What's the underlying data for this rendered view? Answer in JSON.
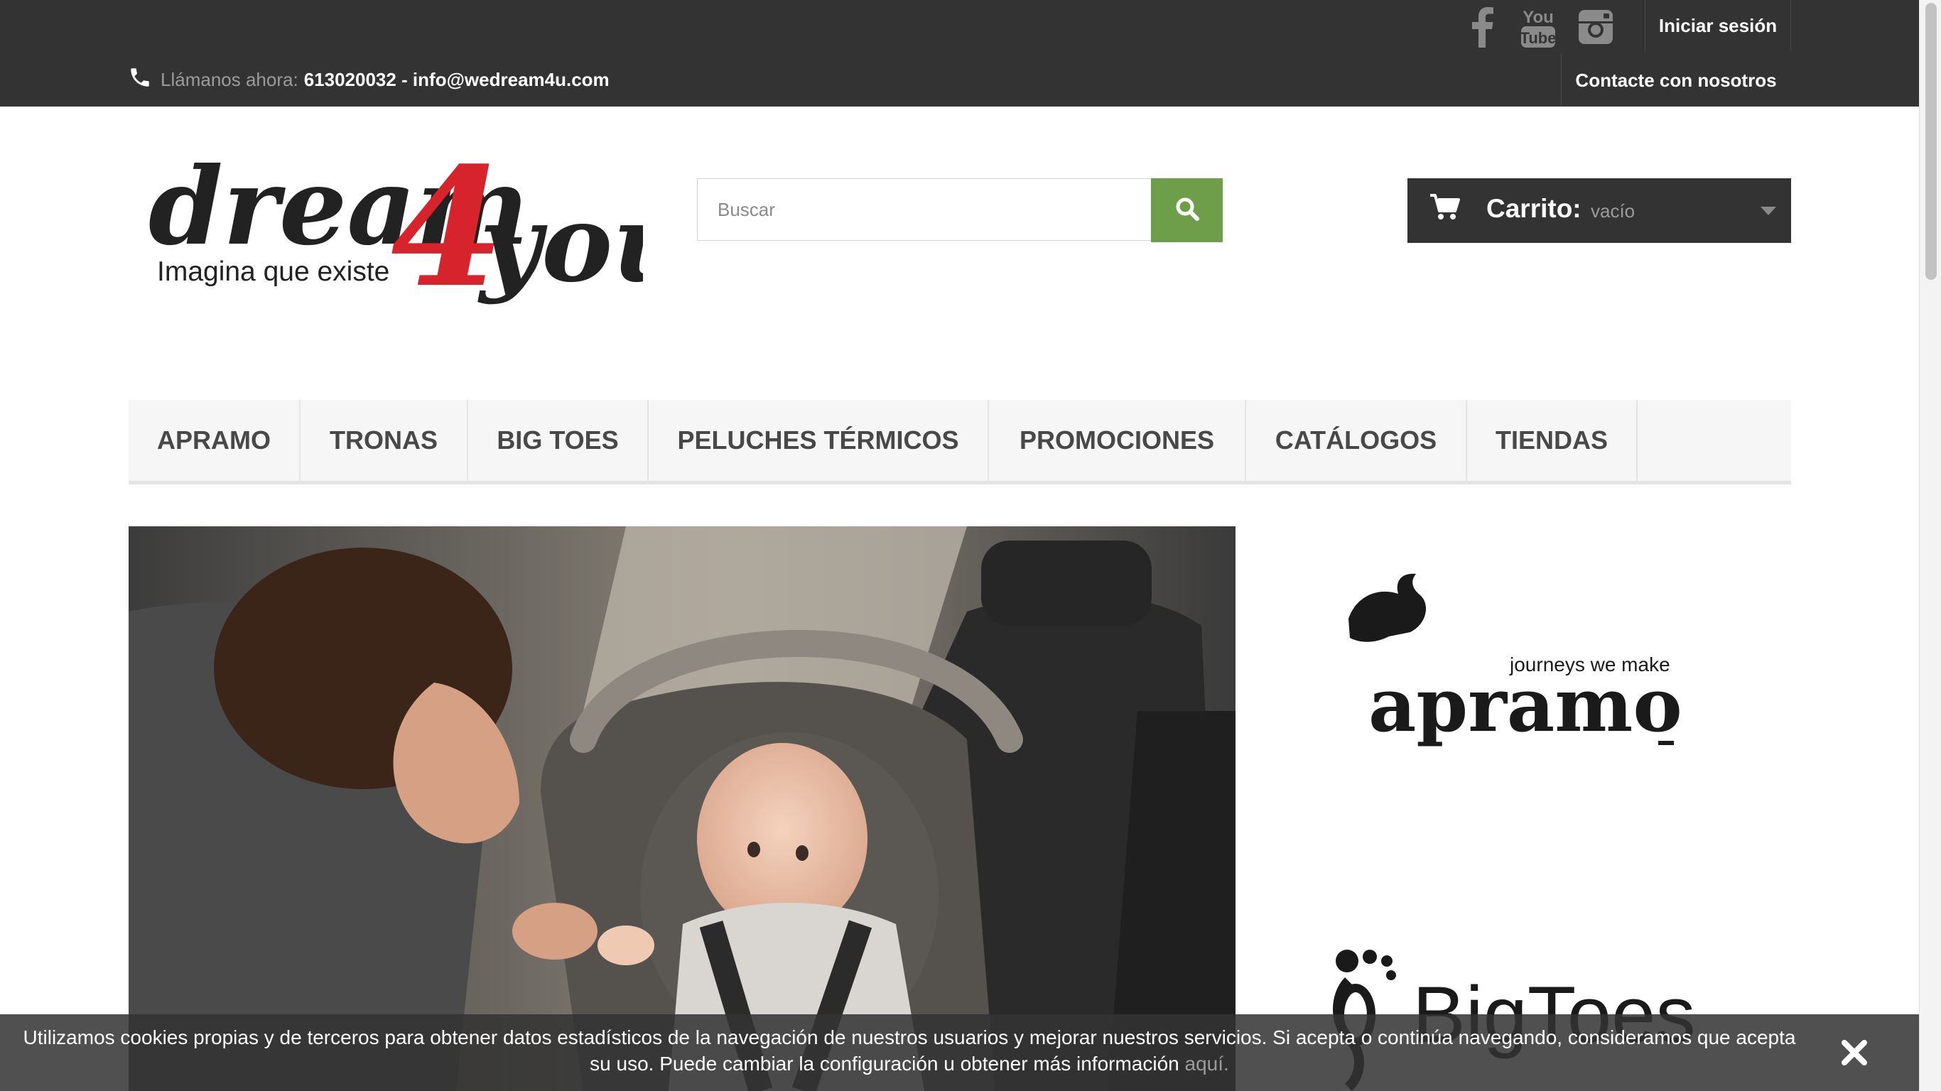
{
  "header": {
    "social": [
      {
        "name": "facebook-icon"
      },
      {
        "name": "youtube-icon",
        "text_top": "You",
        "text_bottom": "Tube"
      },
      {
        "name": "instagram-icon"
      }
    ],
    "login_label": "Iniciar sesión",
    "contact_label": "Contacte con nosotros",
    "call_label": "Llámanos ahora:",
    "call_value": "613020032 - info@wedream4u.com"
  },
  "logo": {
    "word_start": "dream",
    "number": "4",
    "word_end": "you",
    "tagline": "Imagina que existe"
  },
  "search": {
    "placeholder": "Buscar",
    "value": ""
  },
  "cart": {
    "label": "Carrito:",
    "status": "vacío"
  },
  "menu": {
    "items": [
      {
        "label": "APRAMO"
      },
      {
        "label": "TRONAS"
      },
      {
        "label": "BIG TOES"
      },
      {
        "label": "PELUCHES TÉRMICOS"
      },
      {
        "label": "PROMOCIONES"
      },
      {
        "label": "CATÁLOGOS"
      },
      {
        "label": "TIENDAS"
      }
    ]
  },
  "brands": {
    "apramo": {
      "tagline": "journeys we make",
      "name": "apramo"
    },
    "bigtoes": {
      "name": "BigToes"
    }
  },
  "cookie": {
    "line1": "Utilizamos cookies propias y de terceros para obtener datos estadísticos de la navegación de nuestros usuarios y mejorar nuestros servicios. Si acepta o continúa navegando, consideramos que acepta",
    "line2": "su uso. Puede cambiar la configuración u obtener más información",
    "link": "aquí."
  },
  "colors": {
    "topbar": "#333333",
    "accent_green": "#6f9e4a",
    "logo_red": "#d7232b",
    "menu_bg": "#f6f6f6"
  }
}
